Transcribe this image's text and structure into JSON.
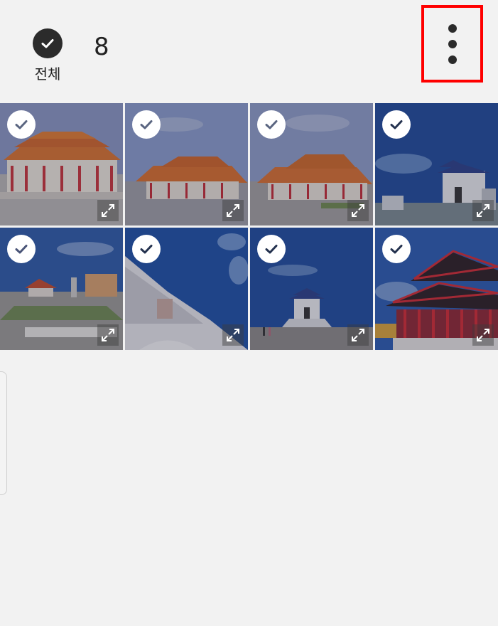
{
  "header": {
    "select_all_label": "전체",
    "selected_count": "8",
    "more_button": "more-options"
  },
  "colors": {
    "highlight_border": "#ff0000",
    "background": "#f2f2f2",
    "check_dark": "#2b2b2b"
  },
  "photos": [
    {
      "subject": "opera-house",
      "selected": true
    },
    {
      "subject": "opera-house",
      "selected": true
    },
    {
      "subject": "opera-house",
      "selected": true
    },
    {
      "subject": "memorial-hall",
      "selected": true
    },
    {
      "subject": "plaza",
      "selected": true
    },
    {
      "subject": "memorial-roof",
      "selected": true
    },
    {
      "subject": "memorial-hall",
      "selected": true
    },
    {
      "subject": "pavilion-red",
      "selected": true
    }
  ]
}
